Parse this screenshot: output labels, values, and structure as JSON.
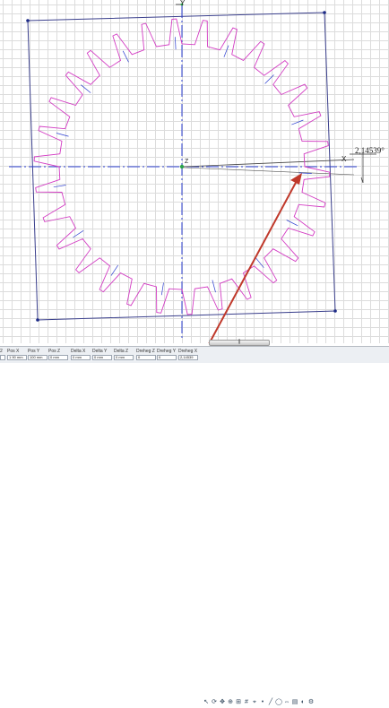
{
  "canvas": {
    "angle_readout": "2,14539°",
    "axis_labels": {
      "y": "Y",
      "x": "X",
      "z": "Z"
    },
    "colors": {
      "gear_outline": "#d33cc3",
      "frame_lines": "#3a3f8c",
      "axis_lines": "#2c3fd0",
      "vertex_points": "#1c2a86",
      "arrow": "#c0392b",
      "grid": "#dcdcdc"
    }
  },
  "scroll_tab": {
    "label": "⫼"
  },
  "statusbar": {
    "fields": [
      {
        "label": "2",
        "value": ""
      },
      {
        "label": "Pos X",
        "value": "1 90 mm"
      },
      {
        "label": "Pos Y",
        "value": "100 mm"
      },
      {
        "label": "Pos Z",
        "value": "0 mm"
      },
      {
        "label": "Delta X",
        "value": "0 mm"
      },
      {
        "label": "Delta Y",
        "value": "0 mm"
      },
      {
        "label": "Delta Z",
        "value": "0 mm"
      },
      {
        "label": "Dreheg Z",
        "value": "0"
      },
      {
        "label": "Dreheg Y",
        "value": "0"
      },
      {
        "label": "Dreheg X",
        "value": "2,14539"
      }
    ],
    "toolbar_icons": [
      "select-icon",
      "rotate-icon",
      "pan-icon",
      "zoom-icon",
      "ruler-icon",
      "grid-icon",
      "snap-icon",
      "point-icon",
      "line-icon",
      "circle-icon",
      "measure-icon",
      "layer-icon",
      "color-icon",
      "settings-icon"
    ]
  }
}
